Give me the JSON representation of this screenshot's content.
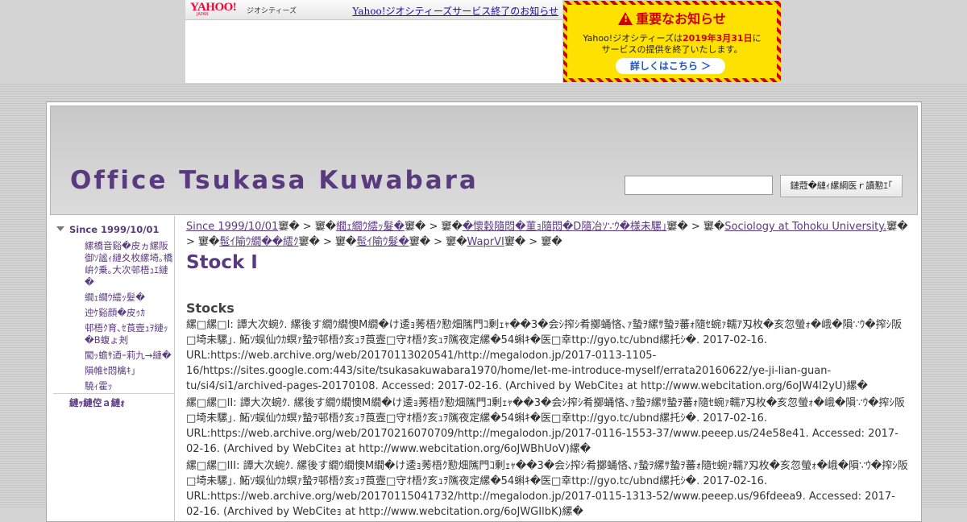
{
  "banner": {
    "yahoo_logo": "YAHOO!",
    "yahoo_logo_sub": "JAPAN",
    "geo_label": "ジオシティーズ",
    "notice_link": "Yahoo!ジオシティーズサービス終了のお知らせ",
    "important_title": "重要なお知らせ",
    "important_line1_a": "Yahoo!ジオシティーズは",
    "important_line1_date": "2019年3月31日",
    "important_line1_b": "に",
    "important_line2": "サービスの提供を終了いたします。",
    "details_button": "詳しくはこちら ＞"
  },
  "header": {
    "site_title": "Office Tsukasa Kuwabara",
    "search_button": "鏈蒄�縺ｨ縲綱医ｒ讀懃ｴ｢"
  },
  "sidebar": {
    "root": "Since 1999/10/01",
    "items": [
      "縲橋音谿�皮ヵ縲阪御ｿ謐ｨ縺夊枚縲埼｡橋峅ｸ乗｡大次邨梧ｭｴ縺�",
      "繝ｪ繝ｳ繧ｯ髮�",
      "迚ｹ谿顔�皮ｩｶ",
      "邨梧ｸ育､ｾ莨壼ｭｦ縺ｯ�B蝮ょ刔",
      "闖ｯ蟾ｻ迺ｰ莉九→縺�",
      "隕帷ｾ悶檎ｷ｣",
      "驍ｨ霍ｯ"
    ],
    "bottom": "縺ｯ縺倥ａ縺ｫ"
  },
  "main": {
    "breadcrumb": [
      {
        "text": "Since 1999/10/01",
        "link": true
      },
      {
        "text": "窶� > 窶�",
        "link": false
      },
      {
        "text": "繝ｪ繝ｳ繧ｯ髮�",
        "link": true
      },
      {
        "text": "窶� > 窶�",
        "link": false
      },
      {
        "text": "�懷穀隨悶�菫ｮ隨悶�D隨冶ｿ∵ｳ�様未騾｣",
        "link": true
      },
      {
        "text": "窶� > 窶�",
        "link": false
      },
      {
        "text": "Sociology at Tohoku University.",
        "link": true
      },
      {
        "text": "窶� > 窶�",
        "link": false
      },
      {
        "text": "髢ｲ隃ｳ繝��繧ｸ",
        "link": true
      },
      {
        "text": "窶� > 窶�",
        "link": false
      },
      {
        "text": "髢ｲ隃ｳ髮�",
        "link": true
      },
      {
        "text": "窶� > 窶�",
        "link": false
      },
      {
        "text": "WaprVI",
        "link": true
      },
      {
        "text": "窶� > 窶�",
        "link": false
      }
    ],
    "page_title": "Stock I",
    "section_title": "Stocks",
    "paragraphs": [
      "縲□縲□I: 譚大次蜿ｸ. 縲後す繝ｳ繝懊M繝�け逶ｮ莠梧ｸ懃畑隲門ｺ剰ｪｬ��3�会ｼ搾ｼ肴擲蛹悋､ｧ蟄ｦ縲ｻ蟄ｦ蕃ｫ隨ｾ蜿ｧ轜ｱ刄枚�亥忽螢ｫ�峨�隕∵ｳ�搾ｼ阪□埼未騾｣. 鮖ｿ蜈仙ｳｶ螟ｧ蟄ｦ邨梧ｸ亥ｭｦ莨壼□守ｵ梧ｸ亥ｭｦ隲夜定縲�54蝌ｷ�医□幸ttp://gyo.tc/ubnd縲托ｼ�. 2017-02-16. URL:https://web.archive.org/web/20170113020541/http://megalodon.jp/2017-0113-1105-16/https://sites.google.com:443/site/tsukasakuwabara1970/home/let-me-introduce-myself/errata20160622/ye-ji-lian-guan-tu/si4/si1/archived-pages-20170108. Accessed: 2017-02-16. (Archived by WebCiteｮ at http://www.webcitation.org/6oJW4l2yU)縲�",
      "縲□縲□II: 譚大次蜿ｸ. 縲後す繝ｳ繝懊M繝�け逶ｮ莠梧ｸ懃畑隲門ｺ剰ｪｬ��3�会ｼ搾ｼ肴擲蛹悋､ｧ蟄ｦ縲ｻ蟄ｦ蕃ｫ隨ｾ蜿ｧ轜ｱ刄枚�亥忽螢ｫ�峨�隕∵ｳ�搾ｼ阪□埼未騾｣. 鮖ｿ蜈仙ｳｶ螟ｧ蟄ｦ邨梧ｸ亥ｭｦ莨壼□守ｵ梧ｸ亥ｭｦ隲夜定縲�54蝌ｷ�医□幸ttp://gyo.tc/ubnd縲托ｼ�. 2017-02-16. URL:https://web.archive.org/web/20170216070709/http://megalodon.jp/2017-0116-1553-37/www.peeep.us/24e58e41. Accessed: 2017-02-16. (Archived by WebCiteｮ at http://www.webcitation.org/6oJWBhUoV)縲�",
      "縲□縲□III: 譚大次蜿ｸ. 縲後す繝ｳ繝懊M繝�け逶ｮ莠梧ｸ懃畑隲門ｺ剰ｪｬ��3�会ｼ搾ｼ肴擲蛹悋､ｧ蟄ｦ縲ｻ蟄ｦ蕃ｫ隨ｾ蜿ｧ轜ｱ刄枚�亥忽螢ｫ�峨�隕∵ｳ�搾ｼ阪□埼未騾｣. 鮖ｿ蜈仙ｳｶ螟ｧ蟄ｦ邨梧ｸ亥ｭｦ莨壼□守ｵ梧ｸ亥ｭｦ隲夜定縲�54蝌ｷ�医□幸ttp://gyo.tc/ubnd縲托ｼ�. 2017-02-16. URL:https://web.archive.org/web/20170115041732/http://megalodon.jp/2017-0115-1313-52/www.peeep.us/96fdeea9. Accessed: 2017-02-16. (Archived by WebCiteｮ at http://www.webcitation.org/6oJWGIlbK)縲�"
    ]
  }
}
